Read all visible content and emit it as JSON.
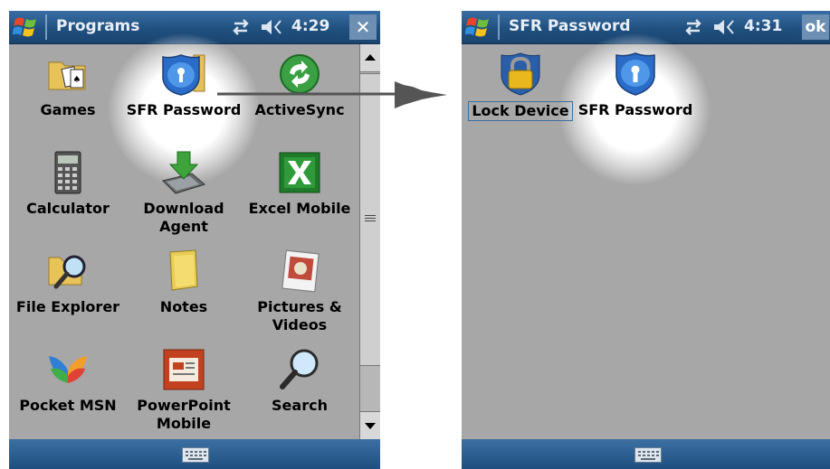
{
  "left_screen": {
    "title": "Programs",
    "time": "4:29",
    "close_label": "✕",
    "items": [
      {
        "label": "Games",
        "icon": "games-icon"
      },
      {
        "label": "SFR Password",
        "icon": "sfr-password-icon"
      },
      {
        "label": "ActiveSync",
        "icon": "activesync-icon"
      },
      {
        "label": "Calculator",
        "icon": "calculator-icon"
      },
      {
        "label": "Download Agent",
        "icon": "download-agent-icon"
      },
      {
        "label": "Excel Mobile",
        "icon": "excel-mobile-icon"
      },
      {
        "label": "File Explorer",
        "icon": "file-explorer-icon"
      },
      {
        "label": "Notes",
        "icon": "notes-icon"
      },
      {
        "label": "Pictures & Videos",
        "icon": "pictures-videos-icon"
      },
      {
        "label": "Pocket MSN",
        "icon": "pocket-msn-icon"
      },
      {
        "label": "PowerPoint Mobile",
        "icon": "powerpoint-mobile-icon"
      },
      {
        "label": "Search",
        "icon": "search-icon"
      }
    ]
  },
  "right_screen": {
    "title": "SFR Password",
    "time": "4:31",
    "ok_label": "ok",
    "items": [
      {
        "label": "Lock Device",
        "icon": "lock-device-icon"
      },
      {
        "label": "SFR Password",
        "icon": "sfr-password-icon"
      }
    ]
  },
  "colors": {
    "titlebar": "#20507f",
    "background": "#a7a7a7",
    "highlight": "#ffffff"
  }
}
